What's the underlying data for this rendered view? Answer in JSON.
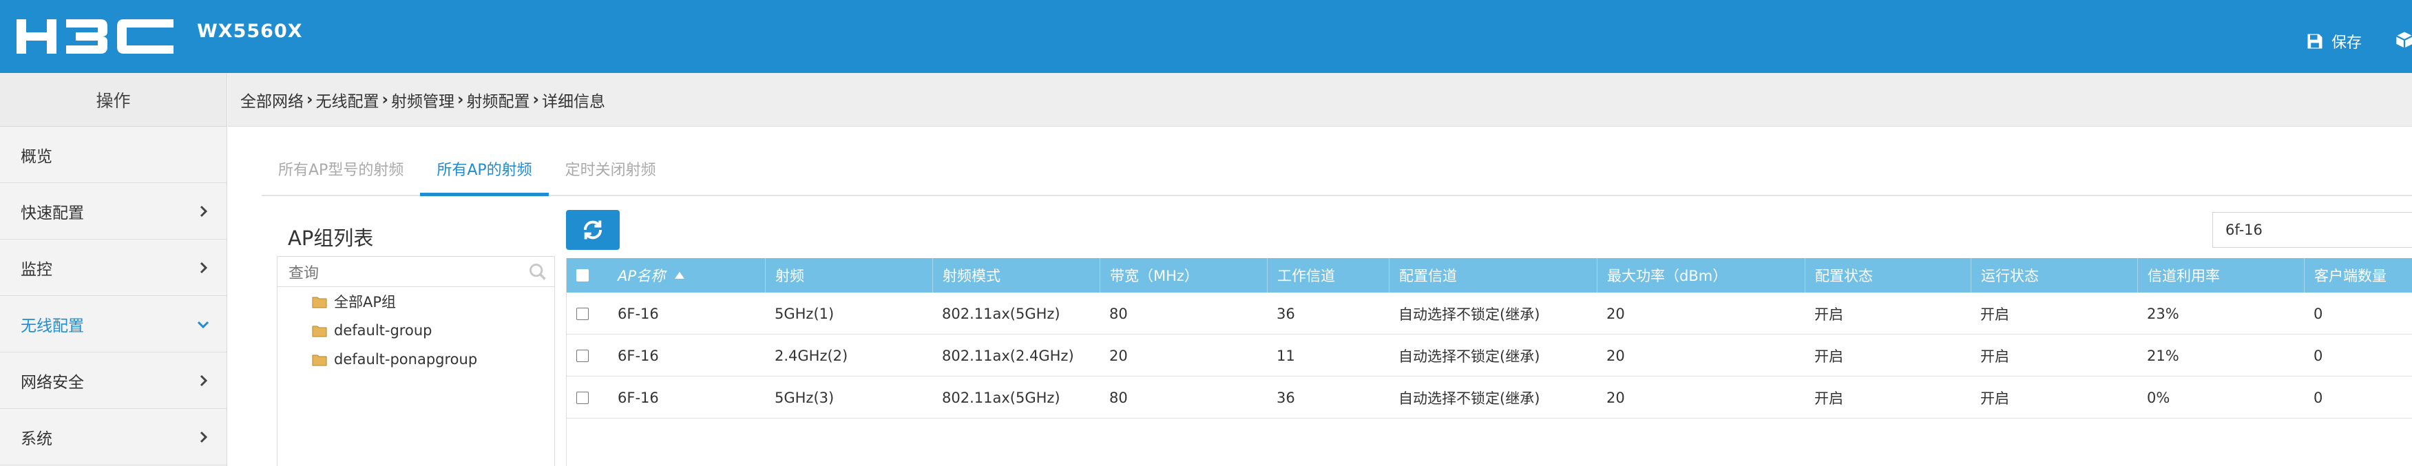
{
  "header": {
    "logo_text": "H3C",
    "model": "WX5560X",
    "save_label": "保存",
    "brand_color": "#1f8dd0"
  },
  "sidebar": {
    "title": "操作",
    "items": [
      {
        "label": "概览",
        "has_chevron": false,
        "active": false
      },
      {
        "label": "快速配置",
        "has_chevron": true,
        "active": false
      },
      {
        "label": "监控",
        "has_chevron": true,
        "active": false
      },
      {
        "label": "无线配置",
        "has_chevron": true,
        "active": true
      },
      {
        "label": "网络安全",
        "has_chevron": true,
        "active": false
      },
      {
        "label": "系统",
        "has_chevron": true,
        "active": false
      }
    ]
  },
  "breadcrumb": [
    "全部网络",
    "无线配置",
    "射频管理",
    "射频配置",
    "详细信息"
  ],
  "tabs": [
    {
      "label": "所有AP型号的射频",
      "active": false
    },
    {
      "label": "所有AP的射频",
      "active": true
    },
    {
      "label": "定时关闭射频",
      "active": false
    }
  ],
  "ap_group": {
    "title": "AP组列表",
    "search_placeholder": "查询",
    "items": [
      "全部AP组",
      "default-group",
      "default-ponapgroup"
    ]
  },
  "filter": {
    "value": "6f-16"
  },
  "table": {
    "columns": [
      "AP名称",
      "射频",
      "射频模式",
      "带宽（MHz）",
      "工作信道",
      "配置信道",
      "最大功率（dBm）",
      "配置状态",
      "运行状态",
      "信道利用率",
      "客户端数量"
    ],
    "rows": [
      [
        "6F-16",
        "5GHz(1)",
        "802.11ax(5GHz)",
        "80",
        "36",
        "自动选择不锁定(继承)",
        "20",
        "开启",
        "开启",
        "23%",
        "0"
      ],
      [
        "6F-16",
        "2.4GHz(2)",
        "802.11ax(2.4GHz)",
        "20",
        "11",
        "自动选择不锁定(继承)",
        "20",
        "开启",
        "开启",
        "21%",
        "0"
      ],
      [
        "6F-16",
        "5GHz(3)",
        "802.11ax(5GHz)",
        "80",
        "36",
        "自动选择不锁定(继承)",
        "20",
        "开启",
        "开启",
        "0%",
        "0"
      ]
    ]
  }
}
